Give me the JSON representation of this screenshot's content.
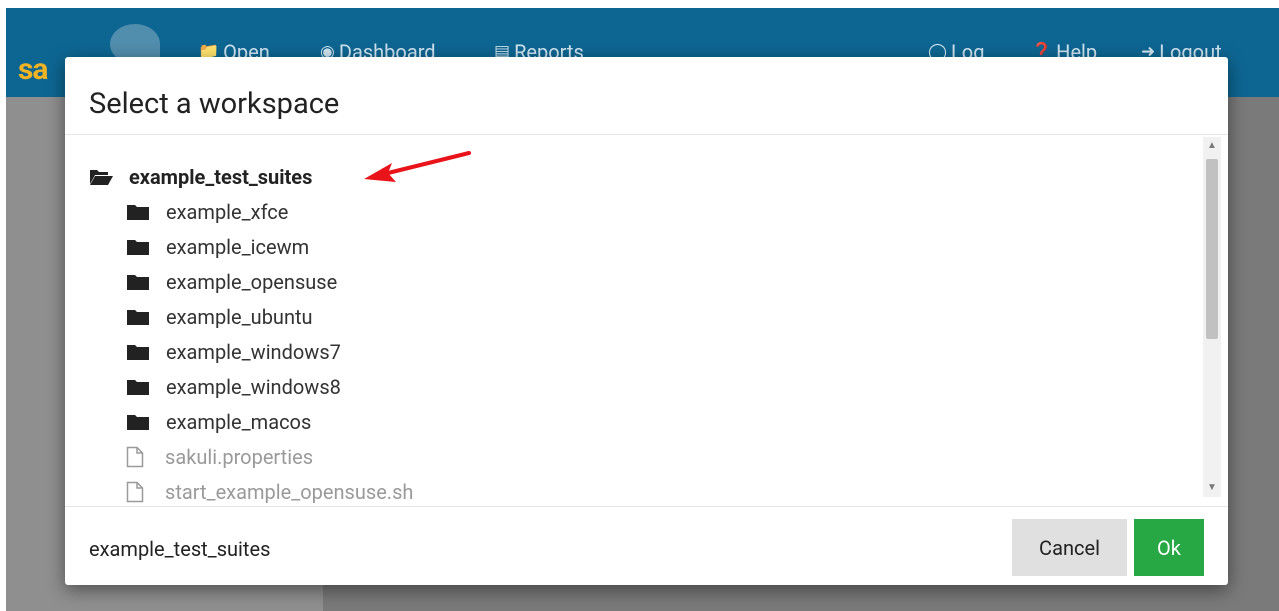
{
  "app": {
    "logo_text": "sa",
    "nav": {
      "open": "Open",
      "dashboard": "Dashboard",
      "reports": "Reports",
      "log": "Log",
      "help": "Help",
      "logout": "Logout"
    }
  },
  "modal": {
    "title": "Select a workspace",
    "tree": {
      "root": "example_test_suites",
      "folders": [
        "example_xfce",
        "example_icewm",
        "example_opensuse",
        "example_ubuntu",
        "example_windows7",
        "example_windows8",
        "example_macos"
      ],
      "files": [
        "sakuli.properties",
        "start_example_opensuse.sh"
      ]
    },
    "footer": {
      "selected_path": "example_test_suites",
      "cancel_label": "Cancel",
      "ok_label": "Ok"
    }
  },
  "colors": {
    "nav_bg": "#0d6692",
    "ok_button": "#28a745",
    "annotation_arrow": "#e8141a"
  },
  "icons": {
    "root": "folder-open-icon",
    "folder": "folder-icon",
    "file": "file-icon"
  }
}
